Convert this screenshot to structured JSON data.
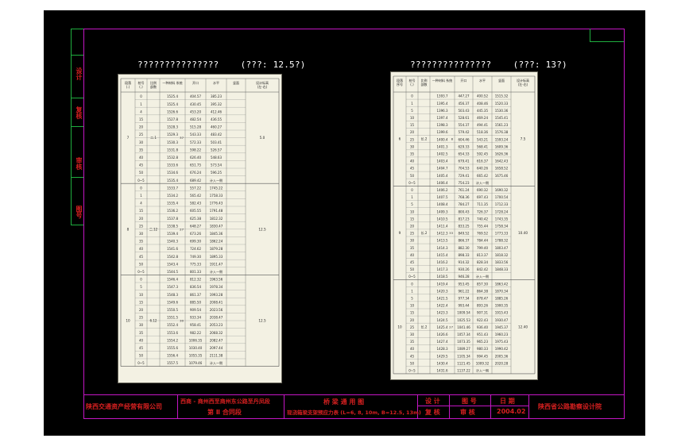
{
  "left_sheet": {
    "title": "???????????????",
    "scale": "(???: 12.5?)",
    "header": [
      "段落\n(.)",
      "桩号\n(.)",
      "比例\n部数",
      "一种材料 系统",
      "开口",
      "水平",
      "竖面",
      "设计标高\n(左-右)"
    ],
    "groups": [
      {
        "group": "7",
        "sub": "二.1",
        "section_no": "37",
        "tag": "5.0",
        "rows": [
          [
            "0",
            "1525.4",
            "404.57",
            "385.23"
          ],
          [
            "1",
            "1525.4",
            "430.45",
            "395.32"
          ],
          [
            "4",
            "1526.6",
            "453.20",
            "412.46"
          ],
          [
            "15",
            "1527.8",
            "482.54",
            "436.55"
          ],
          [
            "20",
            "1528.3",
            "515.28",
            "460.27"
          ],
          [
            "25",
            "1529.3",
            "543.33",
            "483.42"
          ],
          [
            "30",
            "1530.3",
            "572.33",
            "503.41"
          ],
          [
            "35",
            "1531.8",
            "598.22",
            "526.57"
          ],
          [
            "40",
            "1532.8",
            "626.40",
            "548.63"
          ],
          [
            "45",
            "1533.6",
            "651.75",
            "573.54"
          ],
          [
            "50",
            "1534.6",
            "676.24",
            "596.25"
          ],
          [
            "0~5",
            "1535.4",
            "689.42",
            "计入一侧"
          ]
        ]
      },
      {
        "group": "8",
        "sub": "二.12",
        "section_no": "27",
        "tag": "12.5",
        "rows": [
          [
            "0",
            "1533.7",
            "557.22",
            "1745.22"
          ],
          [
            "1",
            "1534.2",
            "565.42",
            "1758.33"
          ],
          [
            "4",
            "1535.4",
            "582.43",
            "1776.43"
          ],
          [
            "15",
            "1536.2",
            "605.55",
            "1791.48"
          ],
          [
            "20",
            "1537.8",
            "625.38",
            "1812.32"
          ],
          [
            "25",
            "1538.5",
            "648.27",
            "1830.47"
          ],
          [
            "30",
            "1539.4",
            "673.26",
            "1845.36"
          ],
          [
            "35",
            "1540.3",
            "699.30",
            "1862.24"
          ],
          [
            "40",
            "1541.6",
            "724.62",
            "1879.28"
          ],
          [
            "45",
            "1542.8",
            "749.30",
            "1895.33"
          ],
          [
            "50",
            "1543.4",
            "775.33",
            "1911.47"
          ],
          [
            "0~5",
            "1544.5",
            "801.33",
            "计入一侧"
          ]
        ]
      },
      {
        "group": "10",
        "sub": "6.12",
        "section_no": "30",
        "tag": "12.5",
        "rows": [
          [
            "0",
            "1546.4",
            "812.32",
            "1963.56"
          ],
          [
            "5",
            "1547.3",
            "836.54",
            "1978.34"
          ],
          [
            "10",
            "1548.3",
            "861.37",
            "1993.28"
          ],
          [
            "15",
            "1549.6",
            "885.50",
            "2008.41"
          ],
          [
            "20",
            "1550.5",
            "909.54",
            "2023.56"
          ],
          [
            "25",
            "1551.5",
            "933.34",
            "2038.47"
          ],
          [
            "30",
            "1552.4",
            "958.41",
            "2053.23"
          ],
          [
            "35",
            "1553.6",
            "982.22",
            "2068.32"
          ],
          [
            "40",
            "1554.2",
            "1006.35",
            "2082.47"
          ],
          [
            "45",
            "1555.6",
            "1030.40",
            "2097.44"
          ],
          [
            "50",
            "1556.4",
            "1055.35",
            "2111.38"
          ],
          [
            "0~5",
            "1557.5",
            "1079.46",
            "计入一侧"
          ]
        ]
      }
    ]
  },
  "right_sheet": {
    "title": "???????????????",
    "scale": "(???: 13?)",
    "header": [
      "段落\n序号",
      "桩号\n(.)",
      "比例\n部数",
      "一种材料 系统",
      "开口",
      "水平",
      "竖面",
      "设计标高\n(左-右)"
    ],
    "groups": [
      {
        "group": "6",
        "sub": "长.2",
        "section_no": "8",
        "tag": "7.5",
        "rows": [
          [
            "0",
            "1393.7",
            "447.27",
            "400.52",
            "1515.32"
          ],
          [
            "1",
            "1395.4",
            "456.37",
            "408.46",
            "1520.33"
          ],
          [
            "5",
            "1396.3",
            "503.43",
            "445.35",
            "1530.36"
          ],
          [
            "10",
            "1397.4",
            "528.61",
            "469.24",
            "1545.41"
          ],
          [
            "15",
            "1398.3",
            "554.37",
            "494.41",
            "1561.23"
          ],
          [
            "20",
            "1399.6",
            "579.42",
            "518.36",
            "1576.38"
          ],
          [
            "25",
            "1400.4",
            "604.46",
            "543.21",
            "1593.24"
          ],
          [
            "30",
            "1401.3",
            "629.33",
            "568.41",
            "1609.36"
          ],
          [
            "35",
            "1402.5",
            "654.33",
            "592.45",
            "1626.36"
          ],
          [
            "40",
            "1403.4",
            "679.41",
            "616.37",
            "1642.43"
          ],
          [
            "45",
            "1404.7",
            "704.53",
            "640.26",
            "1658.52"
          ],
          [
            "50",
            "1405.4",
            "729.41",
            "665.42",
            "1675.46"
          ],
          [
            "0~5",
            "1406.4",
            "754.23",
            "计入一侧",
            ""
          ]
        ]
      },
      {
        "group": "9",
        "sub": "长.2",
        "section_no": "33",
        "tag": "10.40",
        "rows": [
          [
            "0",
            "1406.2",
            "761.24",
            "690.32",
            "1690.32"
          ],
          [
            "1",
            "1407.5",
            "768.36",
            "697.43",
            "1700.54"
          ],
          [
            "5",
            "1408.4",
            "784.27",
            "711.35",
            "1712.33"
          ],
          [
            "10",
            "1409.3",
            "800.43",
            "726.37",
            "1728.24"
          ],
          [
            "15",
            "1410.5",
            "817.23",
            "740.42",
            "1743.35"
          ],
          [
            "20",
            "1411.4",
            "833.25",
            "755.44",
            "1758.34"
          ],
          [
            "25",
            "1412.3",
            "849.52",
            "769.52",
            "1773.33"
          ],
          [
            "30",
            "1413.5",
            "866.37",
            "784.44",
            "1788.32"
          ],
          [
            "35",
            "1414.3",
            "882.30",
            "799.40",
            "1803.47"
          ],
          [
            "40",
            "1415.4",
            "898.33",
            "813.37",
            "1818.32"
          ],
          [
            "45",
            "1416.2",
            "914.32",
            "828.34",
            "1833.56"
          ],
          [
            "50",
            "1417.3",
            "930.26",
            "842.42",
            "1848.33"
          ],
          [
            "0~5",
            "1418.5",
            "946.28",
            "计入一侧",
            ""
          ]
        ]
      },
      {
        "group": "10",
        "sub": "长.2",
        "section_no": "27",
        "tag": "12.40",
        "rows": [
          [
            "0",
            "1419.4",
            "953.45",
            "857.30",
            "1863.42"
          ],
          [
            "1",
            "1420.3",
            "961.22",
            "864.38",
            "1870.34"
          ],
          [
            "5",
            "1421.5",
            "977.34",
            "878.47",
            "1885.26"
          ],
          [
            "10",
            "1422.4",
            "993.44",
            "893.26",
            "1900.35"
          ],
          [
            "15",
            "1423.3",
            "1009.54",
            "907.31",
            "1915.43"
          ],
          [
            "20",
            "1424.5",
            "1025.53",
            "922.43",
            "1930.47"
          ],
          [
            "25",
            "1425.4",
            "1041.46",
            "936.40",
            "1945.37"
          ],
          [
            "30",
            "1426.6",
            "1057.34",
            "951.43",
            "1960.23"
          ],
          [
            "35",
            "1427.4",
            "1073.35",
            "965.23",
            "1975.43"
          ],
          [
            "40",
            "1428.3",
            "1089.27",
            "980.33",
            "1990.42"
          ],
          [
            "45",
            "1429.5",
            "1105.34",
            "994.45",
            "2005.36"
          ],
          [
            "50",
            "1430.4",
            "1121.45",
            "1009.32",
            "2020.28"
          ],
          [
            "0~5",
            "1431.6",
            "1137.22",
            "计入一侧",
            ""
          ]
        ]
      }
    ]
  },
  "title_block": {
    "company": "陕西交通资产经营有限公司",
    "project_line1": "西商 - 商州西至商州东公路至丹凤段",
    "project_line2": "第 Ⅱ 合同段",
    "drawing_line1": "桥 梁 通 用 图",
    "drawing_line2": "现浇箱梁支架预应力表 (L=6, 8, 10m, B=12.5, 13m)",
    "designer_label": "设 计",
    "reviewer_label": "复 核",
    "chart_no_label": "图 号",
    "date_label": "日 期",
    "check_label": "审 核",
    "date": "2004.02",
    "institute": "陕西省公路勘察设计院"
  },
  "side_stamps": [
    "设计",
    "复核",
    "审核",
    "图号"
  ]
}
